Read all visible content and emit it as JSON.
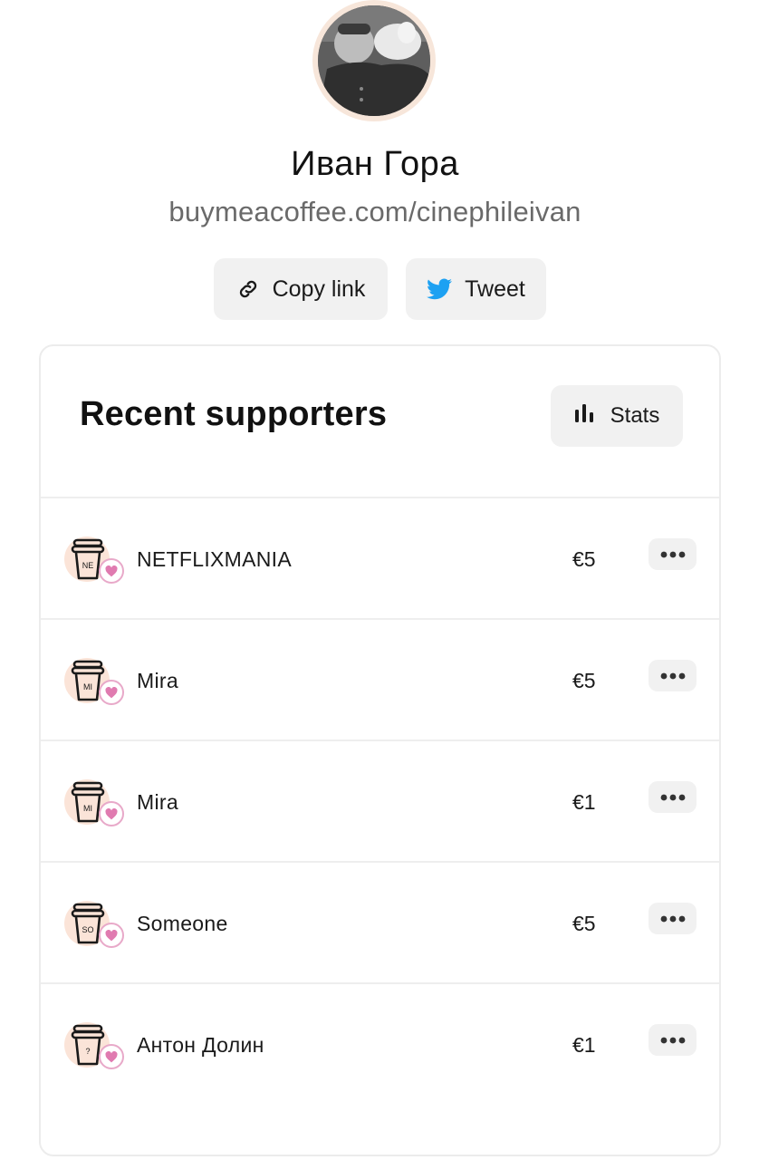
{
  "profile": {
    "name": "Иван Гора",
    "url": "buymeacoffee.com/cinephileivan"
  },
  "actions": {
    "copy_label": "Copy link",
    "tweet_label": "Tweet"
  },
  "supporters": {
    "title": "Recent supporters",
    "stats_label": "Stats",
    "rows": [
      {
        "initials": "NE",
        "name": "NETFLIXMANIA",
        "amount": "€5"
      },
      {
        "initials": "MI",
        "name": "Mira",
        "amount": "€5"
      },
      {
        "initials": "MI",
        "name": "Mira",
        "amount": "€1"
      },
      {
        "initials": "SO",
        "name": "Someone",
        "amount": "€5"
      },
      {
        "initials": "?",
        "name": "Антон Долин",
        "amount": "€1"
      }
    ]
  },
  "colors": {
    "twitter": "#1da1f2",
    "heart": "#e07bb0",
    "avatar_bg": "#fbe4d8"
  },
  "icons": {
    "copy": "link-icon",
    "tweet": "twitter-bird-icon",
    "stats": "bar-chart-icon",
    "more": "more-dots-icon"
  }
}
